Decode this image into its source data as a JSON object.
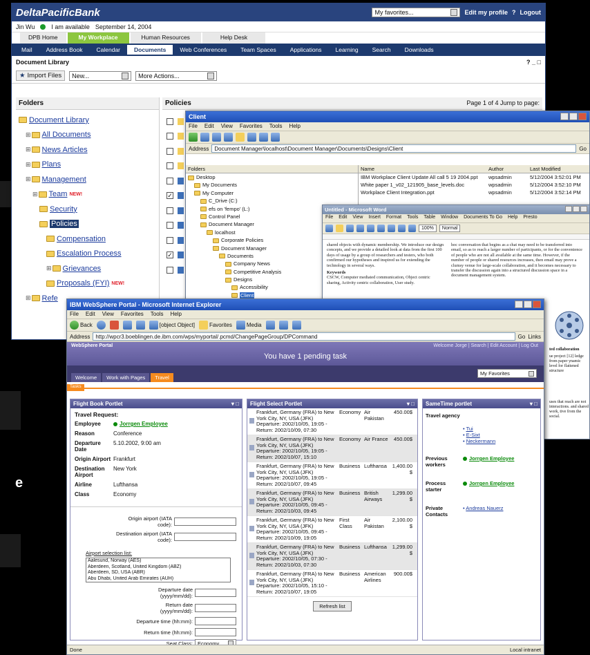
{
  "side_text": {
    "frag1": "d",
    "frag2": "e"
  },
  "bank": {
    "brand": "DeltaPacificBank",
    "favorites_select": "My favorites...",
    "edit_profile": "Edit my profile",
    "help": "?",
    "logout": "Logout",
    "user": "Jin Wu",
    "status": "I am available",
    "date": "September 14, 2004",
    "top_tabs": [
      "DPB Home",
      "My Workplace",
      "Human Resources",
      "Help Desk"
    ],
    "nav": [
      "Mail",
      "Address Book",
      "Calendar",
      "Documents",
      "Web Conferences",
      "Team Spaces",
      "Applications",
      "Learning",
      "Search",
      "Downloads"
    ],
    "section_title": "Document Library",
    "section_ctrls": "? _ □",
    "import_files": "Import Files",
    "new_select": "New...",
    "more_actions": "More Actions...",
    "folders_header": "Folders",
    "policies_header": "Policies",
    "pager": "Page 1 of 4   Jump to page:",
    "tree": [
      {
        "label": "Document Library",
        "indent": 0,
        "link": true
      },
      {
        "label": "All Documents",
        "indent": 1,
        "link": true
      },
      {
        "label": "News Articles",
        "indent": 1,
        "link": true
      },
      {
        "label": "Plans",
        "indent": 1,
        "link": true
      },
      {
        "label": "Management",
        "indent": 1,
        "link": true
      },
      {
        "label": "Team",
        "indent": 2,
        "link": true,
        "badge": "NEW!"
      },
      {
        "label": "Security",
        "indent": 3,
        "link": true
      },
      {
        "label": "Policies",
        "indent": 3,
        "link": false,
        "selected": true
      },
      {
        "label": "Compensation",
        "indent": 4,
        "link": true
      },
      {
        "label": "Escalation Process",
        "indent": 4,
        "link": true
      },
      {
        "label": "Grievances",
        "indent": 4,
        "link": true
      },
      {
        "label": "Proposals (FYI)",
        "indent": 4,
        "link": true,
        "badge": "NEW!"
      },
      {
        "label": "Refe",
        "indent": 1,
        "link": true
      }
    ]
  },
  "client": {
    "title": "Client",
    "menu": [
      "File",
      "Edit",
      "View",
      "Favorites",
      "Tools",
      "Help"
    ],
    "address_label": "Address",
    "address": "Document Manager\\localhost\\Document Manager\\Documents\\Designs\\Client",
    "go": "Go",
    "folders_header": "Folders",
    "tree": [
      "Desktop",
      "My Documents",
      "My Computer",
      "C_Drive (C:)",
      "efs on 'fempo' (L:)",
      "Control Panel",
      "Document Manager",
      "localhost",
      "Corporate Policies",
      "Document Manager",
      "Documents",
      "Company News",
      "Competitive Analysis",
      "Designs",
      "Accessibility",
      "Client",
      "Community"
    ],
    "columns": [
      "Name",
      "Author",
      "Last Modified"
    ],
    "files": [
      {
        "name": "IBM Workplace Client Update All call 5 19 2004.ppt",
        "author": "wpsadmin",
        "modified": "5/12/2004 3:52:01 PM"
      },
      {
        "name": "White paper 1_v02_121905_base_levels.doc",
        "author": "wpsadmin",
        "modified": "5/12/2004 3:52:10 PM"
      },
      {
        "name": "Workplace Client Integration.ppt",
        "author": "wpsadmin",
        "modified": "5/12/2004 3:52:14 PM"
      }
    ]
  },
  "word": {
    "title": "Untitled - Microsoft Word",
    "menu": [
      "File",
      "Edit",
      "View",
      "Insert",
      "Format",
      "Tools",
      "Table",
      "Window",
      "Documents To Go",
      "Help",
      "Presto"
    ],
    "zoom": "100%",
    "style": "Normal",
    "left_col": "shared objects with dynamic membership. We introduce our design concepts, and we provide a detailed look at data from the first 100 days of usage by a group of researchers and testers, who both confirmed our hypotheses and inspired us for extending the technology in several ways.",
    "keywords_label": "Keywords",
    "keywords": "CSCW, Computer mediated communication, Object centric sharing, Activity centric collaboration, User study.",
    "right_col": "hoc conversation that begins as a chat may need to be transferred into email, so as to reach a larger number of participants, or for the convenience of people who are not all available at the same time. However, if the number of people or shared resources increases, then email may prove a clumsy venue for large-scale collaboration, and it becomes necessary to transfer the discussion again into a structured discussion space in a document management system.",
    "fig_caption": "ted collaboration",
    "fig_text": "ue project [12] ledge from paper ynamic level for flattened structure",
    "fig_text2": "uses that reach are not interactions. and shared work, tive from the social."
  },
  "ie": {
    "title": "IBM WebSphere Portal - Microsoft Internet Explorer",
    "menu": [
      "File",
      "Edit",
      "View",
      "Favorites",
      "Tools",
      "Help"
    ],
    "back": "Back",
    "search": {
      "title": "Flight Select Portlet",
      "flights": [
        {
          "route": "Frankfurt, Germany (FRA) to New York City, NY, USA (JFK) Departure: 2002/10/05, 19:05 - Return: 2002/10/09, 07:30",
          "cls": "Economy",
          "airline": "Air Pakistan",
          "price": "450.00$"
        },
        {
          "route": "Frankfurt, Germany (FRA) to New York City, NY, USA (JFK) Departure: 2002/10/05, 19:05 - Return: 2002/10/07, 15:10",
          "cls": "Economy",
          "airline": "Air France",
          "price": "450.00$"
        },
        {
          "route": "Frankfurt, Germany (FRA) to New York City, NY, USA (JFK) Departure: 2002/10/05, 19:05 - Return: 2002/10/07, 09:45",
          "cls": "Business",
          "airline": "Lufthansa",
          "price": "1,400.00 $"
        },
        {
          "route": "Frankfurt, Germany (FRA) to New York City, NY, USA (JFK) Departure: 2002/10/05, 09:45 - Return: 2002/10/03, 09:45",
          "cls": "Business",
          "airline": "British Airways",
          "price": "1,299.00 $"
        },
        {
          "route": "Frankfurt, Germany (FRA) to New York City, NY, USA (JFK) Departure: 2002/10/05, 09:45 - Return: 2002/10/09, 19:05",
          "cls": "First Class",
          "airline": "Air Pakistan",
          "price": "2,100.00 $"
        },
        {
          "route": "Frankfurt, Germany (FRA) to New York City, NY, USA (JFK) Departure: 2002/10/05, 07:30 - Return: 2002/10/03, 07:30",
          "cls": "Business",
          "airline": "Lufthansa",
          "price": "1,299.00 $"
        },
        {
          "route": "Frankfurt, Germany (FRA) to New York City, NY, USA (JFK) Departure: 2002/10/05, 15:10 - Return: 2002/10/07, 19:05",
          "cls": "Business",
          "airline": "American Airlines",
          "price": "900.00$"
        }
      ],
      "refresh": "Refresh list"
    },
    "favorites": "Favorites",
    "media": "Media",
    "address_label": "Address",
    "url": "http://wpcr3.boeblingen.de.ibm.com/wps/myportal/.pcmd/ChangePageGroup/DPCommand",
    "go": "Go",
    "links": "Links",
    "portal_logo": "WebSphere Portal",
    "top_links": "Welcome Jorge | Search | Edit Account | Log Out",
    "pending": "You have 1 pending task",
    "tabs": [
      "Welcome",
      "Work with Pages",
      "Travel"
    ],
    "active_tab": "Tasks",
    "favorites_select": "My Favorites",
    "status_left": "Done",
    "status_right": "Local intranet",
    "booking": {
      "title": "Flight Book Portlet",
      "request": "Travel Request:",
      "employee_label": "Employee",
      "employee": "Jorrgen Employee",
      "fields": [
        {
          "k": "Reason",
          "v": "Conference"
        },
        {
          "k": "Departure Date",
          "v": "5.10.2002, 9:00 am"
        },
        {
          "k": "Origin Airport",
          "v": "Frankfurt"
        },
        {
          "k": "Destination Airport",
          "v": "New York"
        },
        {
          "k": "Airline",
          "v": "Lufthansa"
        },
        {
          "k": "Class",
          "v": "Economy"
        }
      ],
      "origin_label": "Origin airport (IATA code):",
      "dest_label": "Destination airport (IATA code):",
      "airport_list_label": "Airport selection list:",
      "airports": [
        "Aalesund, Norway (AES)",
        "Aberdeen, Scotland, United Kingdom (ABZ)",
        "Aberdeen, SD, USA (ABR)",
        "Abu Dhabi, United Arab Emirates (AUH)"
      ],
      "dep_date": "Departure date (yyyy/mm/dd):",
      "ret_date": "Return date (yyyy/mm/dd):",
      "dep_time": "Departure time (hh:mm):",
      "ret_time": "Return time (hh:mm):",
      "seat_label": "Seat Class:",
      "seat_value": "Economy"
    },
    "people": {
      "title": "SameTime portlet",
      "travel_agency": "Travel agency",
      "agents": [
        "Tui",
        "E-Sixt",
        "Neckermann"
      ],
      "prev_workers": "Previous workers",
      "prev_name": "Jorrgen Employee",
      "starter": "Process starter",
      "starter_name": "Jorrgen Employee",
      "private": "Private Contacts",
      "private_name": "Andreas Nauerz"
    }
  },
  "colors": {
    "bank_blue": "#29447e",
    "nav_blue": "#1d3a6e",
    "workplace_green": "#8cc63f",
    "portal_purple": "#6f6aa8",
    "portal_orange": "#f68b1f"
  }
}
